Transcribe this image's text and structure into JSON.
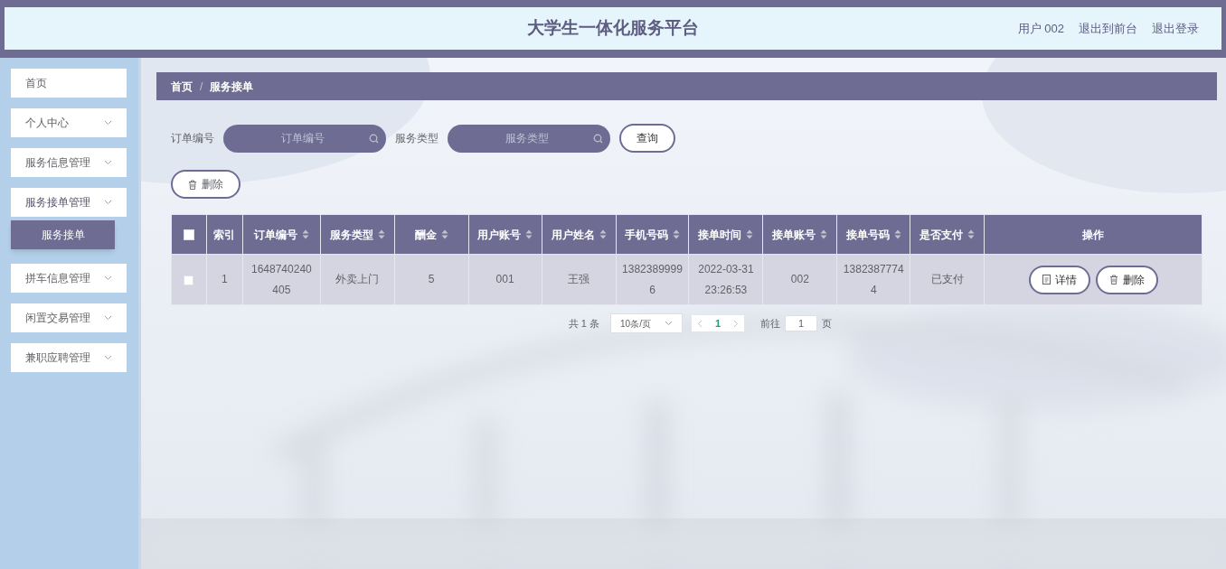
{
  "header": {
    "title": "大学生一体化服务平台",
    "links": [
      "用户 002",
      "退出到前台",
      "退出登录"
    ]
  },
  "sidebar": {
    "items": [
      {
        "label": "首页",
        "has_children": false,
        "expanded": false
      },
      {
        "label": "个人中心",
        "has_children": true,
        "expanded": false
      },
      {
        "label": "服务信息管理",
        "has_children": true,
        "expanded": false
      },
      {
        "label": "服务接单管理",
        "has_children": true,
        "expanded": true,
        "children": [
          {
            "label": "服务接单",
            "selected": true
          }
        ]
      },
      {
        "label": "拼车信息管理",
        "has_children": true,
        "expanded": false
      },
      {
        "label": "闲置交易管理",
        "has_children": true,
        "expanded": false
      },
      {
        "label": "兼职应聘管理",
        "has_children": true,
        "expanded": false
      }
    ]
  },
  "breadcrumb": {
    "items": [
      "首页",
      "服务接单"
    ],
    "separator": "/"
  },
  "search": {
    "fields": [
      {
        "label": "订单编号",
        "placeholder": "订单编号"
      },
      {
        "label": "服务类型",
        "placeholder": "服务类型"
      }
    ],
    "button": "查询"
  },
  "delete_button": "删除",
  "table": {
    "all_checked": false,
    "columns": [
      {
        "label": "索引",
        "sortable": false
      },
      {
        "label": "订单编号",
        "sortable": true
      },
      {
        "label": "服务类型",
        "sortable": true
      },
      {
        "label": "酬金",
        "sortable": true
      },
      {
        "label": "用户账号",
        "sortable": true
      },
      {
        "label": "用户姓名",
        "sortable": true
      },
      {
        "label": "手机号码",
        "sortable": true
      },
      {
        "label": "接单时间",
        "sortable": true
      },
      {
        "label": "接单账号",
        "sortable": true
      },
      {
        "label": "接单号码",
        "sortable": true
      },
      {
        "label": "是否支付",
        "sortable": true
      },
      {
        "label": "操作",
        "sortable": false
      }
    ],
    "rows": [
      {
        "checked": false,
        "cells": [
          "1",
          "1648740240405",
          "外卖上门",
          "5",
          "001",
          "王强",
          "13823899996",
          "2022-03-31 23:26:53",
          "002",
          "13823877744",
          "已支付"
        ],
        "actions": [
          "详情",
          "删除"
        ]
      }
    ]
  },
  "pagination": {
    "total": "共 1 条",
    "page_size": "10条/页",
    "pages": [
      {
        "label": "1",
        "selected": true
      }
    ],
    "goto_label": "前往",
    "goto_value": "1",
    "goto_suffix": "页"
  }
}
